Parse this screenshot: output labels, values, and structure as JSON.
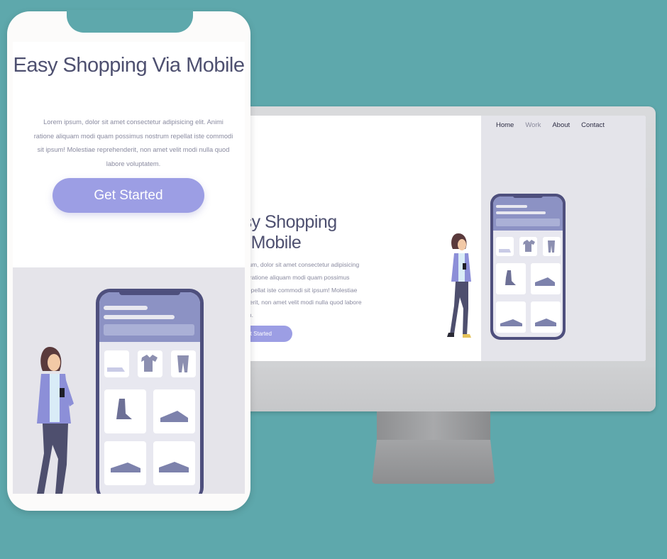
{
  "mobile": {
    "title": "Easy Shopping Via Mobile",
    "body": "Lorem ipsum, dolor sit amet consectetur adipisicing elit. Animi ratione aliquam modi quam possimus nostrum repellat iste commodi sit ipsum! Molestiae reprehenderit, non amet velit modi nulla quod labore voluptatem.",
    "cta_label": "Get Started"
  },
  "desktop": {
    "nav": [
      {
        "label": "Home"
      },
      {
        "label": "Work"
      },
      {
        "label": "About"
      },
      {
        "label": "Contact"
      }
    ],
    "title_line1": "Easy Shopping",
    "title_line2": "Via Mobile",
    "body": "Lorem ipsum, dolor sit amet consectetur adipisicing elit. Animi ratione aliquam modi quam possimus nostrum repellat iste commodi sit ipsum! Molestiae reprehenderit, non amet velit modi nulla quod labore voluptatem.",
    "cta_label": "Get Started"
  },
  "colors": {
    "background": "#5ea8ac",
    "accent": "#9c9ee4",
    "heading": "#4e5070",
    "body_text": "#8a8ba0",
    "panel": "#e5e4ea",
    "phone_outline": "#4e4f7d"
  },
  "illustration": {
    "product_icons": [
      "sneaker-icon",
      "tshirt-icon",
      "pants-icon",
      "boot-icon",
      "shoe-icon",
      "sneaker-icon",
      "shoe-icon"
    ],
    "figure": "woman-with-phone"
  }
}
